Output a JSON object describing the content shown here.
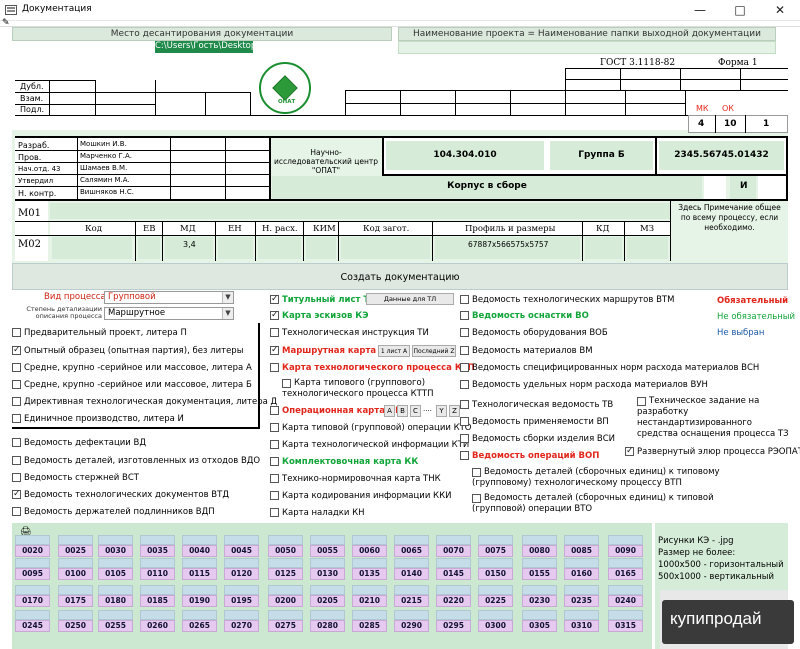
{
  "window": {
    "title": "Документация"
  },
  "header": {
    "place_label": "Место десантирования документации",
    "path": "C:\\Users\\Гость\\Desktop",
    "project_label": "Наименование проекта = Наименование папки выходной документации"
  },
  "stamp": {
    "gost": "ГОСТ 3.1118-82",
    "forma": "Форма 1",
    "dubl": "Дубл.",
    "vzam": "Взам.",
    "podl": "Подл.",
    "mk_label": "МК",
    "ok_label": "ОК",
    "mk_value": "4",
    "ok_value": "10",
    "sheet_value": "1",
    "razrab": "Разраб.",
    "razrab_name": "Мошкин И.В.",
    "prov": "Пров.",
    "prov_name": "Марченко Г.А.",
    "nach": "Нач.отд. 43",
    "nach_name": "Шамаев В.М.",
    "utverd": "Утвердил",
    "utverd_name": "Салямин М.А.",
    "nkontr": "Н. контр.",
    "nkontr_name": "Вишняков Н.С.",
    "org": "Научно-исследовательский центр \"ОПАТ\"",
    "code1": "104.304.010",
    "group": "Группа Б",
    "code2": "2345.56745.01432",
    "product": "Корпус в сборе",
    "i_letter": "И",
    "m01": "М01",
    "m02": "М02",
    "note": "Здесь Примечание общее по всему процессу, если необходимо.",
    "cols": [
      "Код",
      "ЕВ",
      "МД",
      "ЕН",
      "Н. расх.",
      "КИМ",
      "Код загот.",
      "Профиль и размеры",
      "КД",
      "МЗ"
    ],
    "md_value": "3,4",
    "profile_value": "67887х566575х5757",
    "logo_text": "ОПАТ"
  },
  "create_button": "Создать документацию",
  "process": {
    "vid_label": "Вид процесса",
    "vid_value": "Групповой",
    "detail_label": "Степень детализации описания процесса",
    "detail_value": "Маршрутное"
  },
  "liters": [
    {
      "label": "Предварительный проект, литера П",
      "checked": false
    },
    {
      "label": "Опытный образец (опытная партия), без литеры",
      "checked": true
    },
    {
      "label": "Средне, крупно -серийное или массовое, литера А",
      "checked": false
    },
    {
      "label": "Средне, крупно -серийное или массовое, литера Б",
      "checked": false
    },
    {
      "label": "Директивная технологическая документация, литера Д",
      "checked": false
    },
    {
      "label": "Единичное производство, литера И",
      "checked": false
    }
  ],
  "left_docs": [
    {
      "label": "Ведомость дефектации ВД",
      "checked": false
    },
    {
      "label": "Ведомость деталей, изготовленных из отходов ВДО",
      "checked": false
    },
    {
      "label": "Ведомость стержней ВСТ",
      "checked": false
    },
    {
      "label": "Ведомость технологических документов ВТД",
      "checked": true
    },
    {
      "label": "Ведомость держателей подлинников ВДП",
      "checked": false
    }
  ],
  "mid_docs": {
    "title_list": "Титульный лист ТЛ",
    "title_btn": "Данные для ТЛ",
    "sketch": "Карта эскизов КЭ",
    "ti": "Технологическая инструкция ТИ",
    "mk": "Маршрутная карта МК",
    "mk_btn1": "1 лист А",
    "mk_btn2": "Последний Z",
    "ktp": "Карта технологического процесса КТП",
    "kttp": "Карта типового (группового) технологического процесса КТТП",
    "ok": "Операционная карта ОК",
    "ok_btns": [
      "A",
      "B",
      "C",
      "....",
      "Y",
      "Z"
    ],
    "kto": "Карта типовой (групповой) операции КТО",
    "kti": "Карта технологической информации КТИ",
    "kk": "Комплектовочная карта КК",
    "tnk": "Технико-нормировочная карта ТНК",
    "kki": "Карта кодирования информации ККИ",
    "kn": "Карта наладки КН"
  },
  "right_docs": {
    "vtm": "Ведомость технологических маршрутов ВТМ",
    "vo": "Ведомость оснастки ВО",
    "vob": "Ведомость оборудования ВОБ",
    "vm": "Ведомость материалов ВМ",
    "vsn": "Ведомость специфицированных норм расхода материалов ВСН",
    "vun": "Ведомость удельных норм расхода материалов ВУН",
    "tv": "Технологическая ведомость ТВ",
    "vp": "Ведомость применяемости ВП",
    "vsi": "Ведомость сборки изделия ВСИ",
    "vop": "Ведомость операций ВОП",
    "vtp": "Ведомость деталей (сборочных единиц) к типовому (групповому) технологическому процессу ВТП",
    "vto": "Ведомость деталей (сборочных единиц) к типовой (групповой) операции ВТО",
    "tz": "Техническое задание на разработку нестандартизированного средства оснащения процесса ТЗ",
    "reopat": "Развернутый элюр процесса РЭОПАТ"
  },
  "legend": {
    "mandatory": "Обязательный",
    "optional": "Не обязательный",
    "not_selected": "Не выбран"
  },
  "thumbs": {
    "row1": [
      "0020",
      "0025",
      "0030",
      "0035",
      "0040",
      "0045",
      "0050",
      "0055",
      "0060",
      "0065",
      "0070",
      "0075",
      "0080",
      "0085",
      "0090"
    ],
    "row2": [
      "0095",
      "0100",
      "0105",
      "0110",
      "0115",
      "0120",
      "0125",
      "0130",
      "0135",
      "0140",
      "0145",
      "0150",
      "0155",
      "0160",
      "0165"
    ],
    "row3": [
      "0170",
      "0175",
      "0180",
      "0185",
      "0190",
      "0195",
      "0200",
      "0205",
      "0210",
      "0215",
      "0220",
      "0225",
      "0230",
      "0235",
      "0240"
    ],
    "row4": [
      "0245",
      "0250",
      "0255",
      "0260",
      "0265",
      "0270",
      "0275",
      "0280",
      "0285",
      "0290",
      "0295",
      "0300",
      "0305",
      "0310",
      "0315"
    ]
  },
  "image_info": {
    "line1": "Рисунки  КЭ - .jpg",
    "line2": "Размер не более:",
    "line3": "1000х500  - горизонтальный",
    "line4": "500х1000  - вертикальный"
  },
  "watermark": "купипродай",
  "colors": {
    "red": "#e1261c",
    "green": "#12a53a",
    "blue": "#1e5aa6",
    "path_bg": "#1f8a4a"
  }
}
